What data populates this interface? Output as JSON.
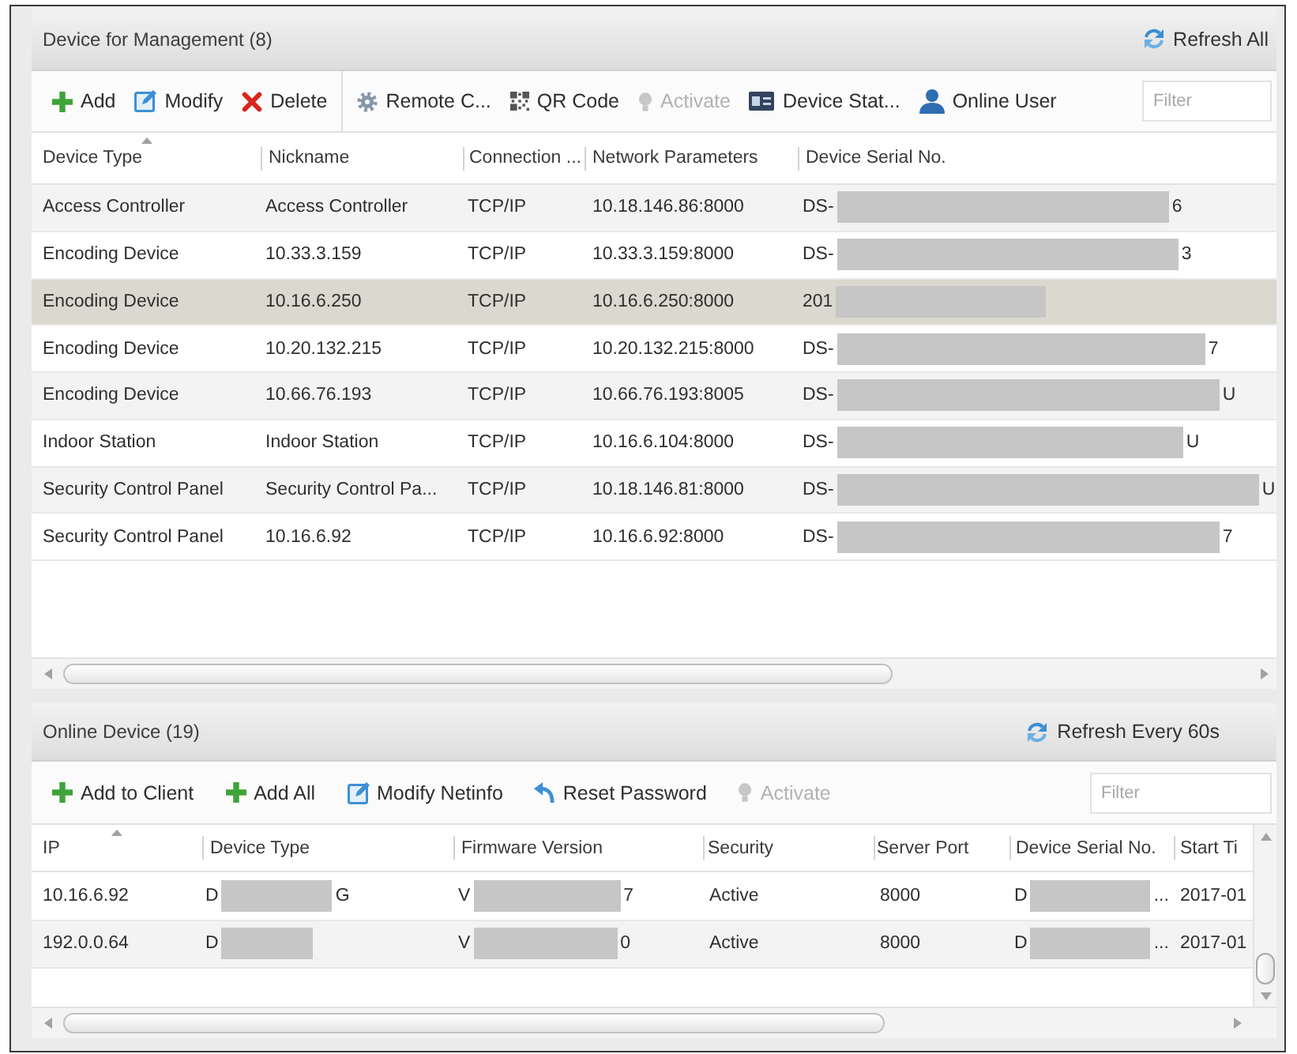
{
  "management": {
    "title": "Device for Management (8)",
    "refresh": "Refresh All",
    "toolbar": {
      "groups": [
        {
          "buttons": [
            {
              "kind": "add",
              "label": "Add",
              "disabled": false
            },
            {
              "kind": "modify",
              "label": "Modify",
              "disabled": false
            },
            {
              "kind": "delete",
              "label": "Delete",
              "disabled": false
            }
          ]
        },
        {
          "buttons": [
            {
              "kind": "remote-config",
              "label": "Remote C...",
              "disabled": false
            },
            {
              "kind": "qr-code",
              "label": "QR Code",
              "disabled": false
            },
            {
              "kind": "activate",
              "label": "Activate",
              "disabled": true
            },
            {
              "kind": "device-status",
              "label": "Device Stat...",
              "disabled": false
            },
            {
              "kind": "online-user",
              "label": "Online User",
              "disabled": false
            }
          ]
        }
      ],
      "filter": {
        "placeholder": "Filter"
      }
    },
    "columns": [
      {
        "label": "Device Type",
        "sorted": true
      },
      {
        "label": "Nickname",
        "sorted": false
      },
      {
        "label": "Connection ...",
        "sorted": false
      },
      {
        "label": "Network Parameters",
        "sorted": false
      },
      {
        "label": "Device Serial No.",
        "sorted": false
      }
    ],
    "rows": [
      {
        "device_type": "Access Controller",
        "nickname": "Access Controller",
        "connection": "TCP/IP",
        "network": "10.18.146.86:8000",
        "serial": {
          "start": "DS-",
          "end": "6"
        },
        "selected": false
      },
      {
        "device_type": "Encoding Device",
        "nickname": "10.33.3.159",
        "connection": "TCP/IP",
        "network": "10.33.3.159:8000",
        "serial": {
          "start": "DS-",
          "end": "3"
        },
        "selected": false
      },
      {
        "device_type": "Encoding Device",
        "nickname": "10.16.6.250",
        "connection": "TCP/IP",
        "network": "10.16.6.250:8000",
        "serial": {
          "start": "201"
        },
        "selected": true
      },
      {
        "device_type": "Encoding Device",
        "nickname": "10.20.132.215",
        "connection": "TCP/IP",
        "network": "10.20.132.215:8000",
        "serial": {
          "start": "DS-",
          "end": "7"
        },
        "selected": false
      },
      {
        "device_type": "Encoding Device",
        "nickname": "10.66.76.193",
        "connection": "TCP/IP",
        "network": "10.66.76.193:8005",
        "serial": {
          "start": "DS-",
          "end": "U"
        },
        "selected": false
      },
      {
        "device_type": "Indoor Station",
        "nickname": "Indoor Station",
        "connection": "TCP/IP",
        "network": "10.16.6.104:8000",
        "serial": {
          "start": "DS-",
          "end": "U"
        },
        "selected": false
      },
      {
        "device_type": "Security Control Panel",
        "nickname": "Security Control Pa...",
        "connection": "TCP/IP",
        "network": "10.18.146.81:8000",
        "serial": {
          "start": "DS-",
          "end": "U"
        },
        "selected": false
      },
      {
        "device_type": "Security Control Panel",
        "nickname": "10.16.6.92",
        "connection": "TCP/IP",
        "network": "10.16.6.92:8000",
        "serial": {
          "start": "DS-",
          "end": "7"
        },
        "selected": false
      }
    ]
  },
  "online": {
    "title": "Online Device (19)",
    "refresh": "Refresh Every 60s",
    "toolbar": {
      "groups": [
        {
          "buttons": [
            {
              "kind": "add",
              "label": "Add to Client",
              "disabled": false
            },
            {
              "kind": "add",
              "label": "Add All",
              "disabled": false
            },
            {
              "kind": "modify",
              "label": "Modify Netinfo",
              "disabled": false
            },
            {
              "kind": "reset-password",
              "label": "Reset Password",
              "disabled": false
            },
            {
              "kind": "activate",
              "label": "Activate",
              "disabled": true
            }
          ]
        }
      ],
      "filter": {
        "placeholder": "Filter"
      }
    },
    "columns": [
      {
        "label": "IP",
        "sorted": true
      },
      {
        "label": "Device Type",
        "sorted": false
      },
      {
        "label": "Firmware Version",
        "sorted": false
      },
      {
        "label": "Security",
        "sorted": false
      },
      {
        "label": "Server Port",
        "sorted": false
      },
      {
        "label": "Device Serial No.",
        "sorted": false
      },
      {
        "label": "Start Ti",
        "sorted": false
      }
    ],
    "rows": [
      {
        "ip": "10.16.6.92",
        "device_type": {
          "start": "D",
          "end": "G"
        },
        "firmware": {
          "start": "V",
          "end": "7"
        },
        "security": "Active",
        "server_port": "8000",
        "serial": {
          "start": "D",
          "end": "..."
        },
        "start_time": "2017-01",
        "selected": false
      },
      {
        "ip": "192.0.0.64",
        "device_type": {
          "start": "D"
        },
        "firmware": {
          "start": "V",
          "end": "0"
        },
        "security": "Active",
        "server_port": "8000",
        "serial": {
          "start": "D",
          "end": "..."
        },
        "start_time": "2017-01",
        "selected": false
      }
    ]
  }
}
